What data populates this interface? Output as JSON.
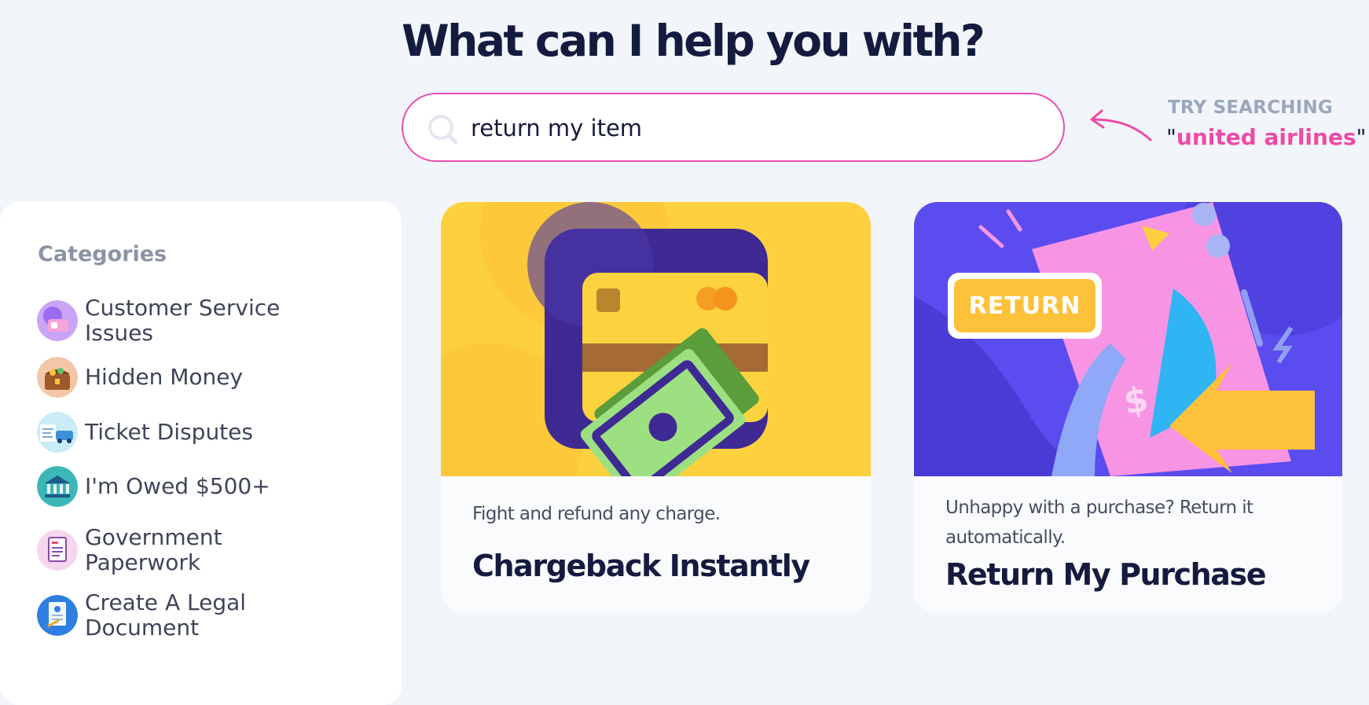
{
  "header": {
    "title": "What can I help you with?"
  },
  "search": {
    "value": "return my item",
    "placeholder": ""
  },
  "hint": {
    "label": "TRY SEARCHING",
    "example": "united airlines",
    "open_quote": "\"",
    "close_quote": "\""
  },
  "sidebar": {
    "title": "Categories",
    "items": [
      {
        "label": "Customer Service Issues",
        "icon": "customer-service-icon"
      },
      {
        "label": "Hidden Money",
        "icon": "treasure-chest-icon"
      },
      {
        "label": "Ticket Disputes",
        "icon": "ticket-icon"
      },
      {
        "label": "I'm Owed $500+",
        "icon": "bank-icon"
      },
      {
        "label": "Government Paperwork",
        "icon": "paperwork-icon"
      },
      {
        "label": "Create A Legal Document",
        "icon": "legal-document-icon"
      }
    ]
  },
  "cards": [
    {
      "desc": "Fight and refund any charge.",
      "title": "Chargeback Instantly"
    },
    {
      "desc": "Unhappy with a purchase? Return it automatically.",
      "title": "Return My Purchase",
      "badge": "RETURN"
    }
  ],
  "colors": {
    "accent_pink": "#e94fb0",
    "heading": "#141b3f",
    "background": "#f2f5fa",
    "card_yellow": "#fdd03f",
    "card_blue": "#5b4cf0"
  }
}
